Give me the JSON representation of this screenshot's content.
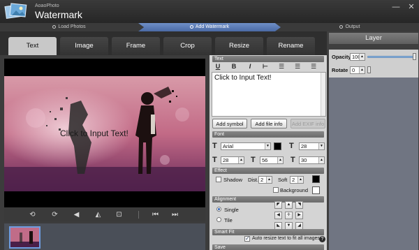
{
  "app": {
    "subtitle": "AoaoPhoto",
    "title": "Watermark"
  },
  "window": {
    "minimize_icon": "minimize-icon",
    "close_icon": "close-icon"
  },
  "steps": [
    {
      "label": "Load Photos",
      "active": false
    },
    {
      "label": "Add Watermark",
      "active": true
    },
    {
      "label": "Output",
      "active": false
    }
  ],
  "tabs": [
    {
      "label": "Text",
      "active": true
    },
    {
      "label": "Image",
      "active": false
    },
    {
      "label": "Frame",
      "active": false
    },
    {
      "label": "Crop",
      "active": false
    },
    {
      "label": "Resize",
      "active": false
    },
    {
      "label": "Rename",
      "active": false
    }
  ],
  "preview": {
    "watermark_text": "Click to Input Text!"
  },
  "preview_tools": [
    "rotate-left-icon",
    "rotate-right-icon",
    "flip-horizontal-icon",
    "flip-vertical-icon",
    "fit-screen-icon",
    "previous-icon",
    "next-icon"
  ],
  "text_panel": {
    "section_label": "Text",
    "format_buttons": [
      "underline-icon",
      "bold-icon",
      "italic-icon",
      "strikethrough-icon",
      "align-left-icon",
      "align-center-icon",
      "align-right-icon"
    ],
    "text_value": "Click to Input Text!",
    "add_symbol": "Add symbol",
    "add_file_info": "Add file info",
    "add_exif_info": "Add EXIF info"
  },
  "font_panel": {
    "section_label": "Font",
    "font_name": "Arial",
    "font_color": "#000000",
    "font_size": "28",
    "line_spacing": "28",
    "letter_height": "56",
    "char_spacing": "30"
  },
  "effect_panel": {
    "section_label": "Effect",
    "shadow_label": "Shadow",
    "dist_label": "Dist.",
    "dist_value": "2",
    "soft_label": "Soft",
    "soft_value": "2",
    "background_label": "Background",
    "shadow_color": "#000000",
    "background_color": "#ffffff"
  },
  "alignment_panel": {
    "section_label": "Alignment",
    "single_label": "Single",
    "tile_label": "Tile",
    "mode": "Single"
  },
  "smartfit_panel": {
    "section_label": "Smart Fit",
    "autoresize_label": "Auto resize text to fit all images",
    "autoresize_checked": true
  },
  "save_panel": {
    "section_label": "Save"
  },
  "layer": {
    "title": "Layer",
    "opacity_label": "Opacity",
    "opacity_value": "100",
    "rotate_label": "Rotate",
    "rotate_value": "0",
    "opacity_level": 1.0,
    "rotate_level": 0
  },
  "colors": {
    "accent": "#5b7db8",
    "titlebar": "#2b2b2b",
    "panel": "#d4d4d4"
  }
}
